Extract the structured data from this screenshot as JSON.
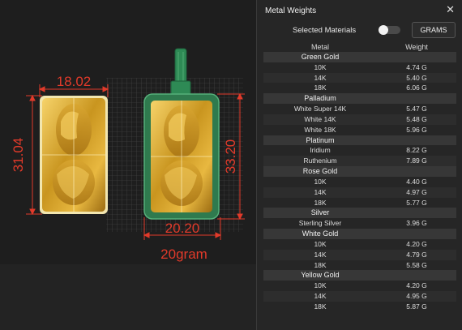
{
  "viewport": {
    "left_bar": {
      "width_label": "18.02",
      "height_label": "31.04"
    },
    "right_bar": {
      "width_label": "20.20",
      "height_label": "33.20"
    },
    "weight_label": "20gram"
  },
  "panel": {
    "title": "Metal Weights",
    "close_icon": "close-icon",
    "selected_materials_label": "Selected Materials",
    "units_button": "GRAMS",
    "headers": {
      "metal": "Metal",
      "weight": "Weight"
    },
    "groups": [
      {
        "name": "Green Gold",
        "rows": [
          {
            "metal": "10K",
            "weight": "4.74 G"
          },
          {
            "metal": "14K",
            "weight": "5.40 G"
          },
          {
            "metal": "18K",
            "weight": "6.06 G"
          }
        ]
      },
      {
        "name": "Palladium",
        "rows": [
          {
            "metal": "White Super 14K",
            "weight": "5.47 G"
          },
          {
            "metal": "White 14K",
            "weight": "5.48 G"
          },
          {
            "metal": "White 18K",
            "weight": "5.96 G"
          }
        ]
      },
      {
        "name": "Platinum",
        "rows": [
          {
            "metal": "Iridium",
            "weight": "8.22 G"
          },
          {
            "metal": "Ruthenium",
            "weight": "7.89 G"
          }
        ]
      },
      {
        "name": "Rose Gold",
        "rows": [
          {
            "metal": "10K",
            "weight": "4.40 G"
          },
          {
            "metal": "14K",
            "weight": "4.97 G"
          },
          {
            "metal": "18K",
            "weight": "5.77 G"
          }
        ]
      },
      {
        "name": "Silver",
        "rows": [
          {
            "metal": "Sterling Silver",
            "weight": "3.96 G"
          }
        ]
      },
      {
        "name": "White Gold",
        "rows": [
          {
            "metal": "10K",
            "weight": "4.20 G"
          },
          {
            "metal": "14K",
            "weight": "4.79 G"
          },
          {
            "metal": "18K",
            "weight": "5.58 G"
          }
        ]
      },
      {
        "name": "Yellow Gold",
        "rows": [
          {
            "metal": "10K",
            "weight": "4.20 G"
          },
          {
            "metal": "14K",
            "weight": "4.95 G"
          },
          {
            "metal": "18K",
            "weight": "5.87 G"
          }
        ]
      }
    ]
  }
}
